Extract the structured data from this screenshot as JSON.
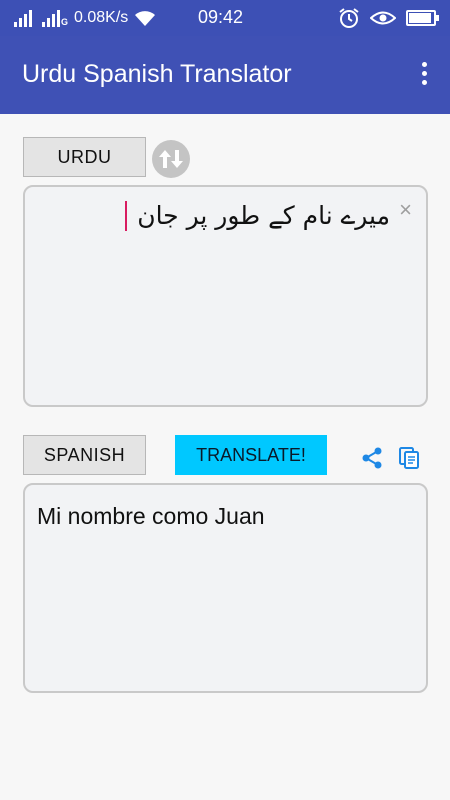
{
  "status_bar": {
    "network_speed": "0.08K/s",
    "time": "09:42",
    "sim2_tag": "G",
    "battery_level": 0.9
  },
  "app": {
    "title": "Urdu Spanish Translator"
  },
  "source": {
    "language_label": "URDU",
    "text": "میرے نام کے طور پر جان",
    "clear_symbol": "×"
  },
  "target": {
    "language_label": "SPANISH",
    "translate_label": "TRANSLATE!",
    "text": "Mi nombre como Juan"
  },
  "colors": {
    "app_bar": "#3f51b5",
    "translate_button": "#00c8ff",
    "icon_blue": "#1e88e5",
    "caret": "#d81b60"
  }
}
